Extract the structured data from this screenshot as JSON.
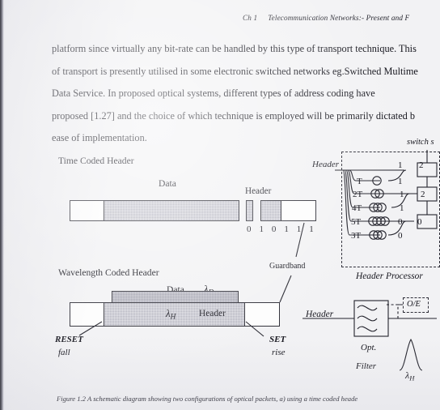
{
  "page": {
    "background_color": "#f2f2f4",
    "ink_color": "#15151d"
  },
  "running_head": {
    "chapter": "Ch 1",
    "title": "Telecommunication Networks:- Present and F"
  },
  "body": {
    "lines": [
      "platform since virtually any bit-rate can be handled by this type of transport technique.  This",
      "of transport is presently utilised in some electronic switched networks eg.Switched Multime",
      "Data  Service.   In  proposed  optical  systems,  different  types  of  address  coding  have",
      "proposed [1.27] and the choice of which technique is employed will be primarily dictated b",
      "ease of implementation."
    ]
  },
  "figure": {
    "time_coded": {
      "section_label": "Time Coded Header",
      "data_label": "Data",
      "header_label": "Header",
      "bits": "0 1 0 1 1 1",
      "guardband_label": "Guardband"
    },
    "wavelength_coded": {
      "section_label": "Wavelength Coded Header",
      "data_label": "Data",
      "lambda_data": "λ",
      "lambda_data_sub": "D",
      "lambda_header": "λ",
      "lambda_header_sub": "H",
      "header_label": "Header",
      "reset_label": "RESET",
      "reset_sub_label": "fall",
      "set_label": "SET",
      "set_sub_label": "rise"
    },
    "header_processor": {
      "input_label": "Header",
      "title": "Header Processor",
      "switch_label": "switch s",
      "delay_lines": [
        {
          "delay": "T",
          "loops": 1,
          "bit": "1"
        },
        {
          "delay": "2T",
          "loops": 2,
          "bit": "1"
        },
        {
          "delay": "4T",
          "loops": 3,
          "bit": "1"
        },
        {
          "delay": "5T",
          "loops": 4,
          "bit": "0"
        },
        {
          "delay": "3T",
          "loops": 3,
          "bit": "0"
        }
      ],
      "bus_bits": [
        "1",
        "2",
        "1",
        "2",
        "0",
        "0"
      ]
    },
    "optical_filter": {
      "input_label": "Header",
      "filter_label_line1": "Opt.",
      "filter_label_line2": "Filter",
      "oe_label": "O/E",
      "pulse_lambda": "λ",
      "pulse_lambda_sub": "H"
    }
  },
  "caption": {
    "text": "Figure 1.2  A schematic diagram showing two configurations of optical packets, a) using a time coded heade"
  }
}
